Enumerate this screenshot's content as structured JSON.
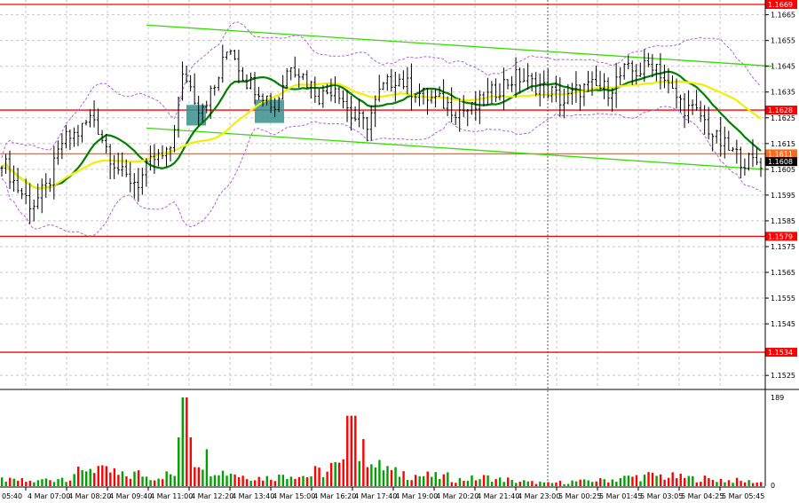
{
  "chart_data": {
    "type": "candlestick",
    "instrument_timeframe": "",
    "price_axis": {
      "ylim": [
        1.152,
        1.1671
      ],
      "ticks": [
        "1.1665",
        "1.1655",
        "1.1645",
        "1.1635",
        "1.1625",
        "1.1615",
        "1.1605",
        "1.1595",
        "1.1585",
        "1.1575",
        "1.1565",
        "1.1555",
        "1.1545",
        "1.1525"
      ]
    },
    "time_axis": {
      "ticks": [
        "05:40",
        "4 Mar 07:00",
        "4 Mar 08:20",
        "4 Mar 09:40",
        "4 Mar 11:00",
        "4 Mar 12:20",
        "4 Mar 13:40",
        "4 Mar 15:00",
        "4 Mar 16:20",
        "4 Mar 17:40",
        "4 Mar 19:00",
        "4 Mar 20:20",
        "4 Mar 21:40",
        "4 Mar 23:00",
        "5 Mar 00:25",
        "5 Mar 01:45",
        "5 Mar 03:05",
        "5 Mar 04:25",
        "5 Mar 05:45"
      ]
    },
    "close_path": [
      1.1609,
      1.1598,
      1.1591,
      1.1598,
      1.1616,
      1.1619,
      1.1626,
      1.1612,
      1.1602,
      1.16,
      1.1609,
      1.161,
      1.1643,
      1.1629,
      1.1636,
      1.1654,
      1.164,
      1.1636,
      1.1629,
      1.1647,
      1.164,
      1.1633,
      1.1638,
      1.1626,
      1.1622,
      1.1636,
      1.1641,
      1.1636,
      1.1633,
      1.1631,
      1.1628,
      1.1628,
      1.1633,
      1.1638,
      1.1641,
      1.1638,
      1.1636,
      1.1631,
      1.1636,
      1.1637,
      1.1636,
      1.1643,
      1.1643,
      1.1647,
      1.1636,
      1.1629,
      1.1626,
      1.1617,
      1.1612,
      1.1608,
      1.1608
    ],
    "levels": [
      {
        "price": 1.1669,
        "label": "1.1669",
        "color": "#ff0000"
      },
      {
        "price": 1.1628,
        "label": "1.1628",
        "color": "#ff0000"
      },
      {
        "price": 1.1579,
        "label": "1.1579",
        "color": "#ff0000"
      },
      {
        "price": 1.1534,
        "label": "1.1534",
        "color": "#ff0000"
      },
      {
        "price": 1.1611,
        "label": "1.1611",
        "color": "#ff6a1a"
      }
    ],
    "current_price": {
      "price": 1.1608,
      "label": "1.1608"
    },
    "channel": {
      "upper": [
        1.1661,
        1.1645
      ],
      "lower": [
        1.1621,
        1.1605
      ],
      "color": "#33dd00"
    },
    "moving_averages": [
      {
        "color": "#008000",
        "period": 14
      },
      {
        "color": "#f0f000",
        "period": 30
      }
    ],
    "envelope_color": "#b060e0",
    "entry_zones": [
      {
        "price_top": 1.163,
        "price_bottom": 1.1622
      },
      {
        "price_top": 1.1632,
        "price_bottom": 1.1623
      }
    ],
    "volume": {
      "max_label": "189",
      "min_label": "0",
      "ylim": [
        0,
        189
      ],
      "path": [
        14,
        12,
        10,
        14,
        18,
        28,
        40,
        30,
        22,
        26,
        20,
        24,
        189,
        60,
        40,
        30,
        22,
        18,
        20,
        26,
        22,
        30,
        40,
        150,
        70,
        40,
        28,
        24,
        22,
        20,
        14,
        16,
        18,
        14,
        10,
        8,
        6,
        8,
        10,
        12,
        14,
        18,
        20,
        22,
        20,
        18,
        16,
        14,
        12,
        10,
        8
      ]
    },
    "colors": {
      "up": "#00a000",
      "down": "#ff0000",
      "bars": "#000000",
      "grid": "#c8c8c8"
    }
  }
}
